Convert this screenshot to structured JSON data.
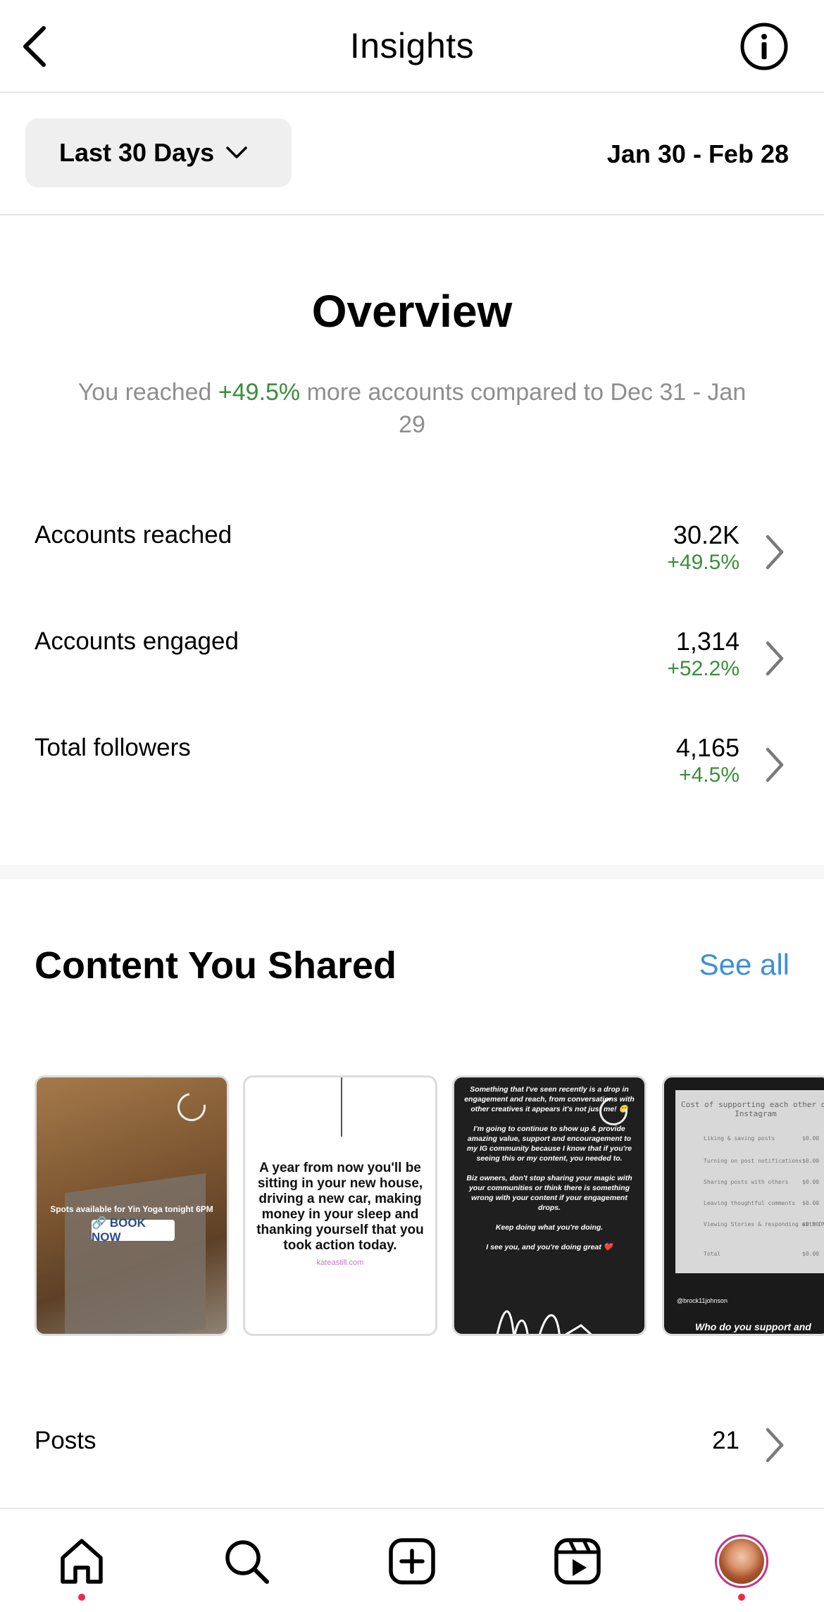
{
  "header": {
    "title": "Insights"
  },
  "date_filter": {
    "range_label": "Last 30 Days",
    "date_range": "Jan 30 - Feb 28"
  },
  "overview": {
    "title": "Overview",
    "desc_prefix": "You reached ",
    "desc_change": "+49.5%",
    "desc_suffix": " more accounts compared to Dec 31 - Jan 29",
    "metrics": [
      {
        "label": "Accounts reached",
        "value": "30.2K",
        "change": "+49.5%"
      },
      {
        "label": "Accounts engaged",
        "value": "1,314",
        "change": "+52.2%"
      },
      {
        "label": "Total followers",
        "value": "4,165",
        "change": "+4.5%"
      }
    ]
  },
  "content_shared": {
    "title": "Content You Shared",
    "see_all": "See all",
    "thumbs": [
      {
        "caption": "Spots available for Yin Yoga tonight 6PM",
        "button": "🔗 BOOK NOW"
      },
      {
        "text": "A year from now you'll be sitting in your new house, driving a new car, making money in your sleep and thanking yourself that you took action today.",
        "url": "kateastill.com"
      },
      {
        "text": "Something that I've seen recently is a drop in engagement and reach, from conversations with other creatives it appears it's not just me! 😬\n\nI'm going to continue to show up & provide amazing value, support and encouragement to my IG community because I know that if you're seeing this or my content, you needed to.\n\nBiz owners, don't stop sharing your magic with your communities or think there is something wrong with your content if your engagement drops.\n\nKeep doing what you're doing.\n\nI see you, and you're doing great ❤️"
      },
      {
        "title": "Cost of supporting each other on Instagram",
        "lines": [
          "Liking & saving posts",
          "Turning on post notifications",
          "Sharing posts with others",
          "Leaving thoughtful comments",
          "Viewing Stories & responding with DMs",
          "Total"
        ],
        "amount": "$0.00",
        "handle": "@brock11johnson",
        "question": "Who do you support and"
      }
    ],
    "posts_label": "Posts",
    "posts_count": "21"
  },
  "nav": {
    "items": [
      "home",
      "search",
      "create",
      "reels",
      "profile"
    ]
  },
  "colors": {
    "green": "#3a8e3a",
    "link": "#3d8fdd",
    "notification": "#ec2a4c"
  }
}
